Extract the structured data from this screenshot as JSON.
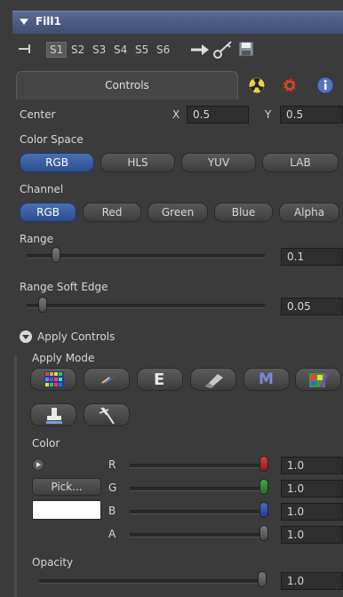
{
  "header": {
    "title": "Fill1"
  },
  "toolbar": {
    "slots": [
      "S1",
      "S2",
      "S3",
      "S4",
      "S5",
      "S6"
    ]
  },
  "tabs": {
    "controls_label": "Controls"
  },
  "center": {
    "label": "Center",
    "x_label": "X",
    "x_value": "0.5",
    "y_label": "Y",
    "y_value": "0.5"
  },
  "color_space": {
    "label": "Color Space",
    "options": [
      "RGB",
      "HLS",
      "YUV",
      "LAB"
    ],
    "selected": "RGB"
  },
  "channel": {
    "label": "Channel",
    "options": [
      "RGB",
      "Red",
      "Green",
      "Blue",
      "Alpha"
    ],
    "selected": "RGB"
  },
  "range": {
    "label": "Range",
    "value": "0.1"
  },
  "range_soft_edge": {
    "label": "Range Soft Edge",
    "value": "0.05"
  },
  "apply_controls": {
    "label": "Apply Controls",
    "apply_mode_label": "Apply Mode",
    "mode_icons": [
      "normal-icon",
      "merge-icon",
      "e-icon",
      "erase-icon",
      "matte-icon",
      "color-map-icon",
      "stamp-icon",
      "wand-icon"
    ],
    "mode_glyph_e": "E",
    "mode_glyph_m": "M"
  },
  "color": {
    "label": "Color",
    "pick_label": "Pick...",
    "swatch_color": "#ffffff",
    "channels": [
      {
        "name": "R",
        "value": "1.0",
        "color": "#b03030"
      },
      {
        "name": "G",
        "value": "1.0",
        "color": "#2f8a2f"
      },
      {
        "name": "B",
        "value": "1.0",
        "color": "#3050a8"
      },
      {
        "name": "A",
        "value": "1.0",
        "color": "#666666"
      }
    ]
  },
  "opacity": {
    "label": "Opacity",
    "value": "1.0"
  },
  "colors": {
    "selected_button": "#3b5fa3",
    "panel_bg": "#3b3b3b",
    "title_bg": "#4a5a82"
  }
}
